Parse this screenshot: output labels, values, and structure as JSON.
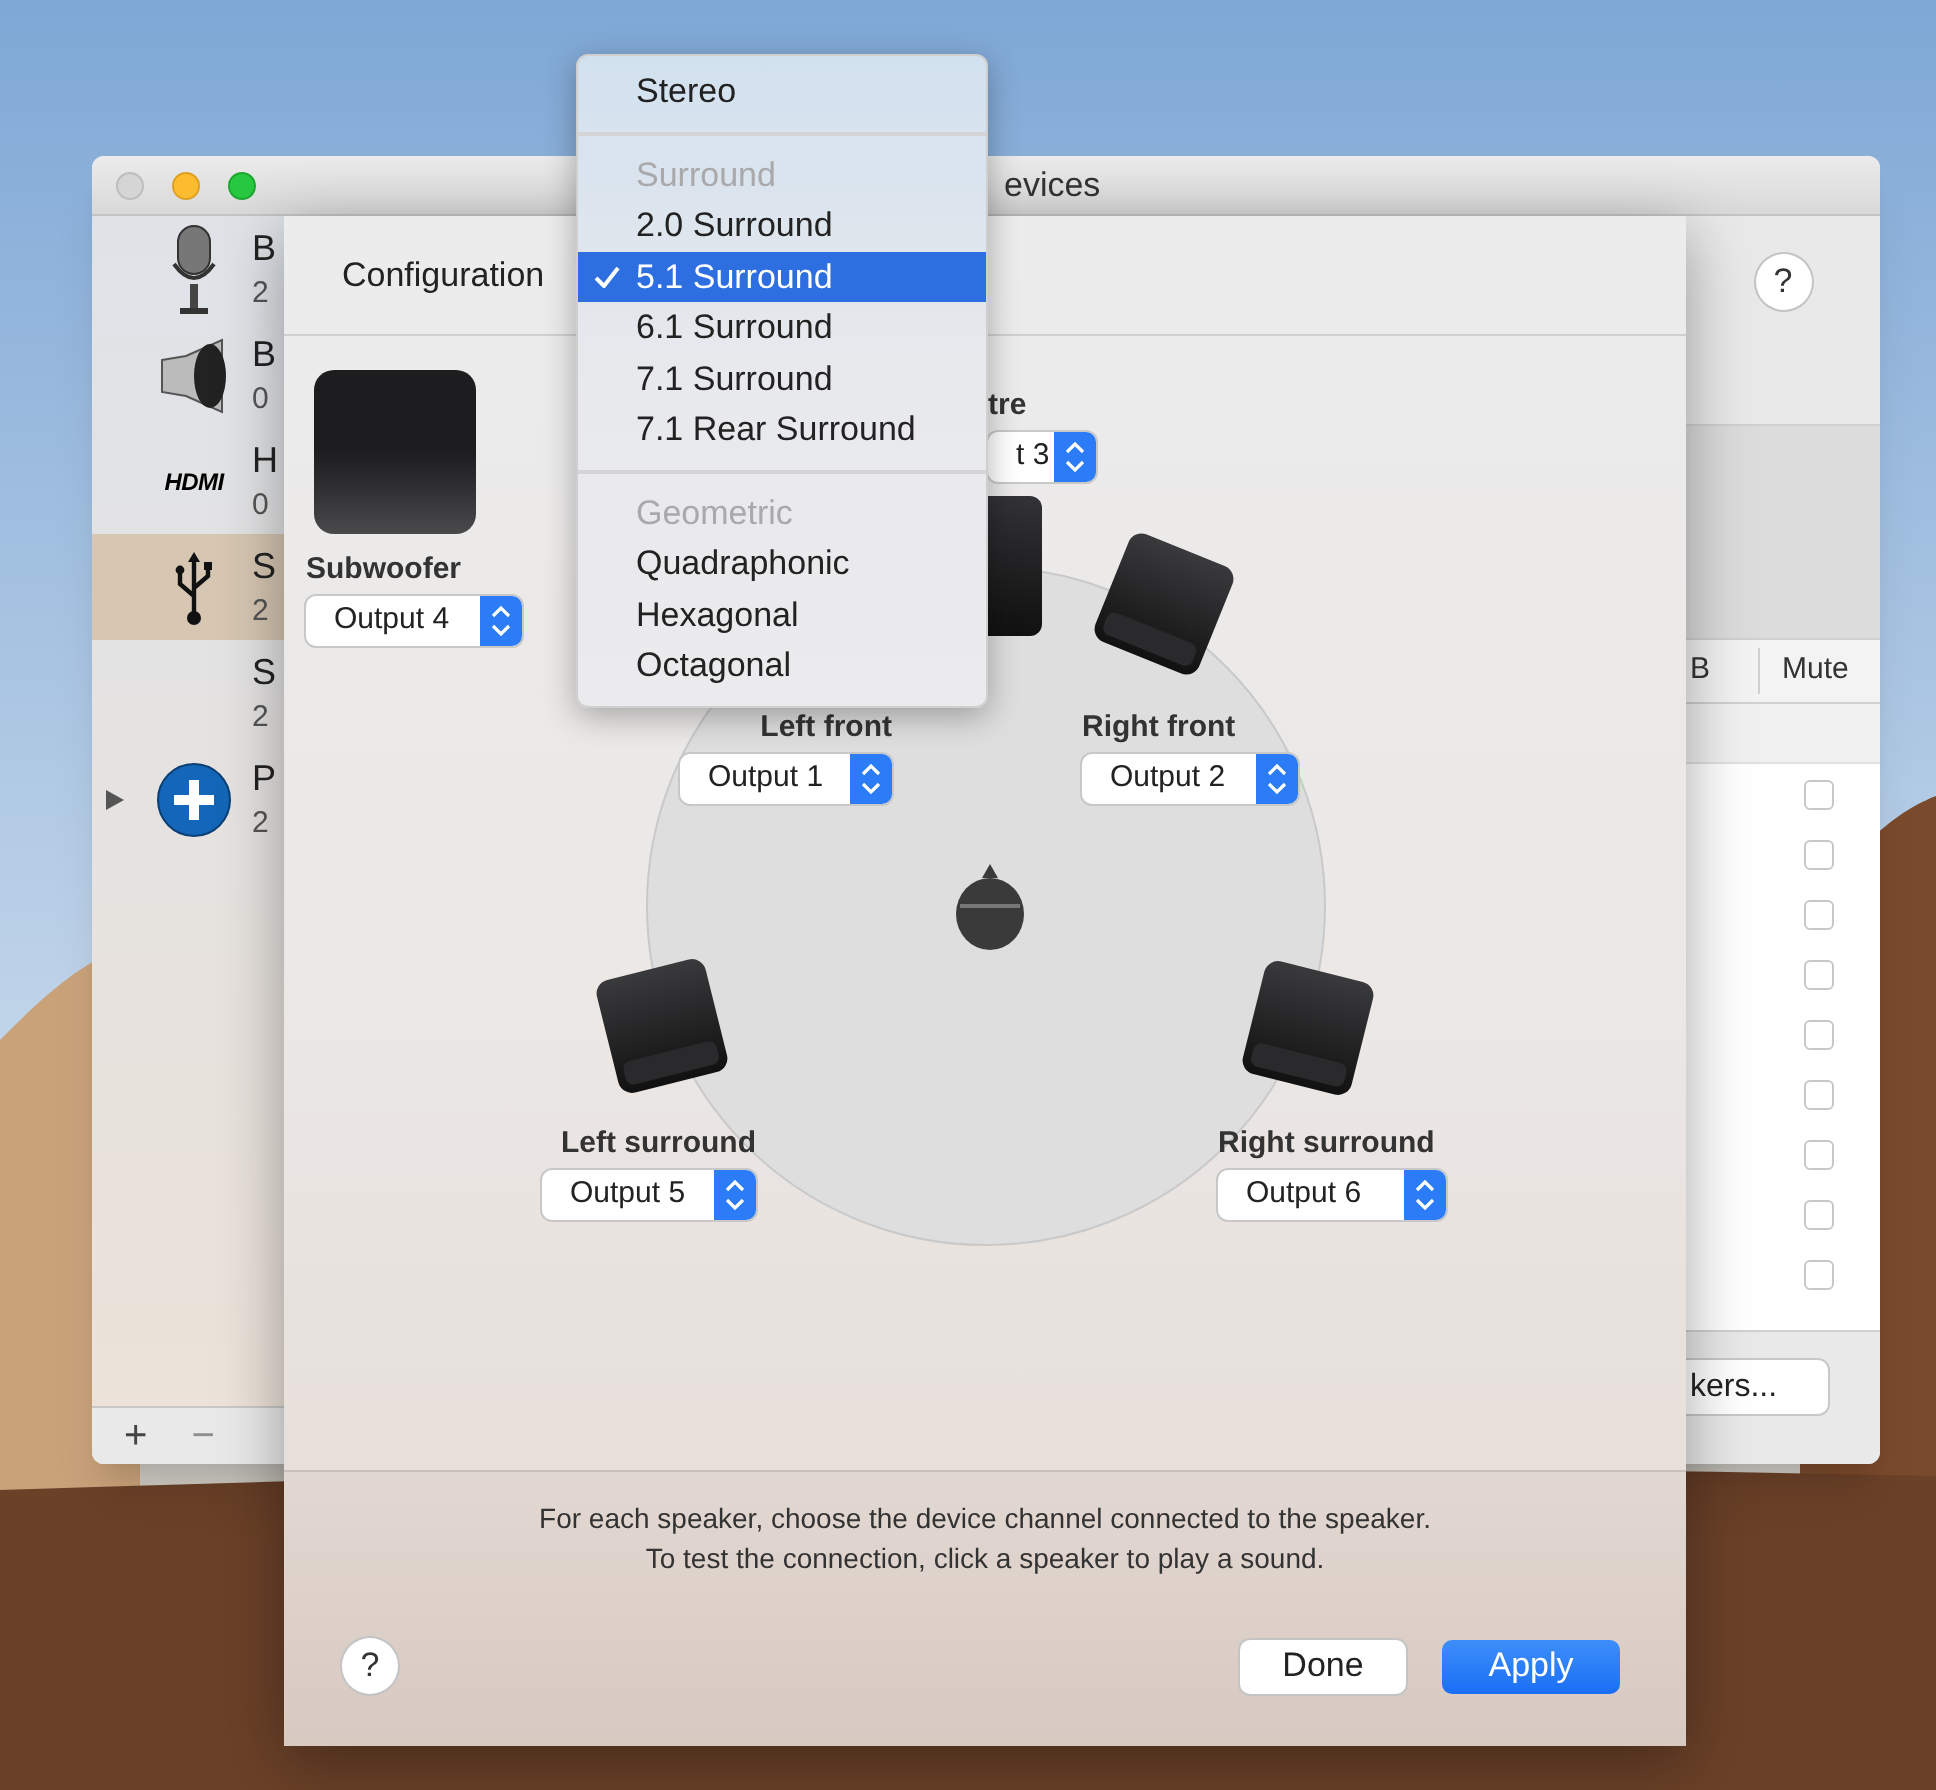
{
  "window": {
    "title": "evices"
  },
  "sidebar": {
    "items": [
      {
        "kind": "microphone",
        "name": "B",
        "detail": "2",
        "selected": false,
        "expandable": false
      },
      {
        "kind": "speaker",
        "name": "B",
        "detail": "0",
        "selected": false,
        "expandable": false
      },
      {
        "kind": "hdmi",
        "logo": "HDMI",
        "name": "H",
        "detail": "0",
        "selected": false,
        "expandable": false
      },
      {
        "kind": "usb",
        "name": "S",
        "detail": "2",
        "selected": true,
        "expandable": false
      },
      {
        "kind": "plain",
        "name": "S",
        "detail": "2",
        "selected": false,
        "expandable": false
      },
      {
        "kind": "aggregate",
        "name": "P",
        "detail": "2",
        "selected": false,
        "expandable": true
      }
    ]
  },
  "sidebar_footer": [
    {
      "label": "+",
      "disabled": false
    },
    {
      "label": "−",
      "disabled": true
    }
  ],
  "help_button": "?",
  "table": {
    "columns": [
      "B",
      "Mute"
    ],
    "rows": [
      {
        "mute": false
      },
      {
        "mute": false
      },
      {
        "mute": false
      },
      {
        "mute": false
      },
      {
        "mute": false
      },
      {
        "mute": false
      },
      {
        "mute": false
      },
      {
        "mute": false
      },
      {
        "mute": false
      }
    ]
  },
  "configure_button": "kers...",
  "sheet": {
    "configuration_label": "Configuration",
    "speakers": [
      {
        "kind": "subwoofer",
        "name": "Subwoofer",
        "output": "Output 4"
      },
      {
        "kind": "centre",
        "name": "tre",
        "output": "t 3"
      },
      {
        "kind": "left_front",
        "name": "Left front",
        "output": "Output 1"
      },
      {
        "kind": "right_front",
        "name": "Right front",
        "output": "Output 2"
      },
      {
        "kind": "left_surround",
        "name": "Left surround",
        "output": "Output 5"
      },
      {
        "kind": "right_surround",
        "name": "Right surround",
        "output": "Output 6"
      }
    ],
    "instructions": [
      "For each speaker, choose the device channel connected to the speaker.",
      "To test the connection, click a speaker to play a sound."
    ],
    "help_button": "?",
    "buttons": [
      {
        "label": "Done",
        "primary": false
      },
      {
        "label": "Apply",
        "primary": true
      }
    ]
  },
  "menu": {
    "items": [
      {
        "kind": "item",
        "label": "Stereo",
        "selected": false
      },
      {
        "kind": "separator"
      },
      {
        "kind": "header",
        "label": "Surround"
      },
      {
        "kind": "item",
        "label": "2.0 Surround",
        "selected": false
      },
      {
        "kind": "item",
        "label": "5.1 Surround",
        "selected": true
      },
      {
        "kind": "item",
        "label": "6.1 Surround",
        "selected": false
      },
      {
        "kind": "item",
        "label": "7.1 Surround",
        "selected": false
      },
      {
        "kind": "item",
        "label": "7.1 Rear Surround",
        "selected": false
      },
      {
        "kind": "separator"
      },
      {
        "kind": "header",
        "label": "Geometric"
      },
      {
        "kind": "item",
        "label": "Quadraphonic",
        "selected": false
      },
      {
        "kind": "item",
        "label": "Hexagonal",
        "selected": false
      },
      {
        "kind": "item",
        "label": "Octagonal",
        "selected": false
      }
    ]
  }
}
